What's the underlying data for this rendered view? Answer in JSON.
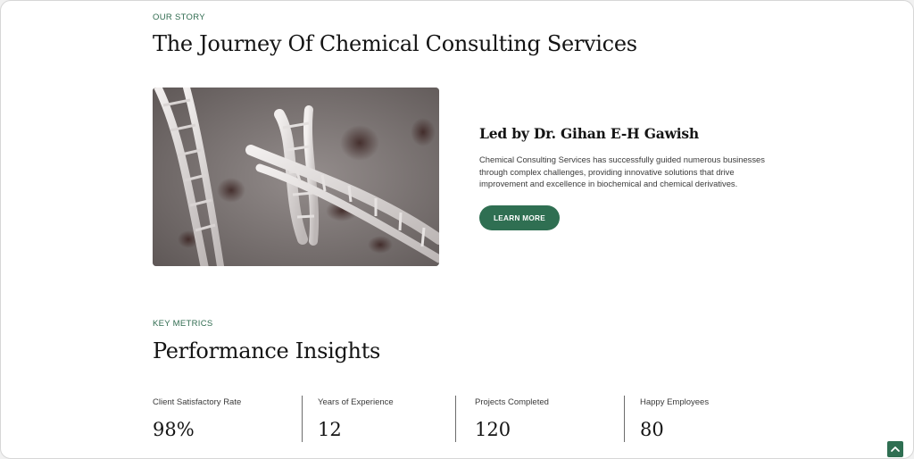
{
  "story": {
    "eyebrow": "OUR STORY",
    "title": "The Journey Of Chemical Consulting Services",
    "image_icon": "dna-helix-image",
    "about_title": "Led by Dr. Gihan E-H Gawish",
    "about_text": "Chemical Consulting Services has successfully guided numerous businesses through complex challenges, providing innovative solutions that drive improvement and excellence in biochemical and chemical derivatives.",
    "button_label": "LEARN MORE"
  },
  "metrics": {
    "eyebrow": "KEY METRICS",
    "title": "Performance Insights",
    "items": [
      {
        "label": "Client Satisfactory Rate",
        "value": "98%"
      },
      {
        "label": "Years of Experience",
        "value": "12"
      },
      {
        "label": "Projects Completed",
        "value": "120"
      },
      {
        "label": "Happy Employees",
        "value": "80"
      }
    ]
  },
  "scroll_top": {
    "icon": "chevron-up-icon"
  },
  "colors": {
    "accent": "#2f6f52",
    "heading": "#141414",
    "body_text": "#3a3a3a",
    "background": "#ffffff"
  }
}
